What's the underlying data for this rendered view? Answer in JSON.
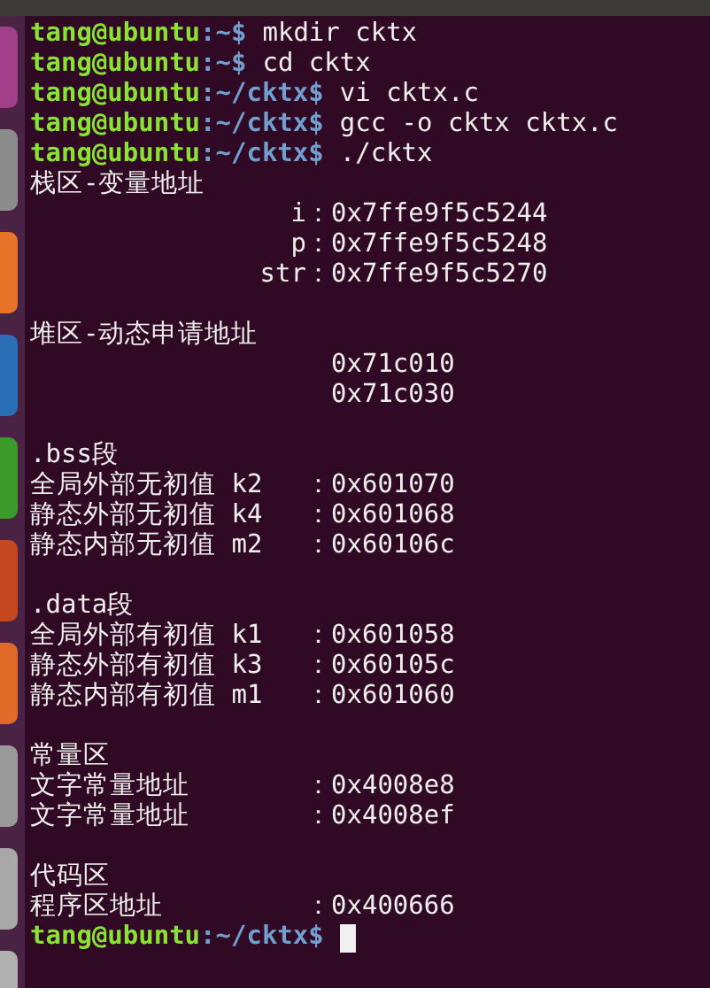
{
  "launcher": {
    "tiles": [
      {
        "color": "#a23f8a"
      },
      {
        "color": "#8c8c8c"
      },
      {
        "color": "#e8742a"
      },
      {
        "color": "#2a6fb5"
      },
      {
        "color": "#3c9a2a"
      },
      {
        "color": "#c4471f"
      },
      {
        "color": "#e06a28"
      },
      {
        "color": "#9a9a9a"
      },
      {
        "color": "#a8a8a8"
      },
      {
        "color": "#b0b0b0"
      }
    ]
  },
  "terminal": {
    "lines": [
      {
        "kind": "prompt",
        "user": "tang@ubuntu",
        "path": ":~$",
        "command": "mkdir cktx"
      },
      {
        "kind": "prompt",
        "user": "tang@ubuntu",
        "path": ":~$",
        "command": "cd cktx"
      },
      {
        "kind": "prompt",
        "user": "tang@ubuntu",
        "path": ":~/cktx$",
        "command": "vi cktx.c"
      },
      {
        "kind": "prompt",
        "user": "tang@ubuntu",
        "path": ":~/cktx$",
        "command": "gcc -o cktx cktx.c"
      },
      {
        "kind": "prompt",
        "user": "tang@ubuntu",
        "path": ":~/cktx$",
        "command": "./cktx"
      },
      {
        "kind": "heading",
        "text": "栈区-变量地址"
      },
      {
        "kind": "stack_address",
        "label": "i",
        "colon": "：",
        "value": "0x7ffe9f5c5244"
      },
      {
        "kind": "stack_address",
        "label": "p",
        "colon": "：",
        "value": "0x7ffe9f5c5248"
      },
      {
        "kind": "stack_address",
        "label": "str",
        "colon": "：",
        "value": "0x7ffe9f5c5270"
      },
      {
        "kind": "blank"
      },
      {
        "kind": "heading",
        "text": "堆区-动态申请地址"
      },
      {
        "kind": "address",
        "value": "0x71c010"
      },
      {
        "kind": "address",
        "value": "0x71c030"
      },
      {
        "kind": "blank"
      },
      {
        "kind": "heading",
        "text": ".bss段"
      },
      {
        "kind": "address",
        "label": "全局外部无初值 k2",
        "colon": "：",
        "value": "0x601070"
      },
      {
        "kind": "address",
        "label": "静态外部无初值 k4",
        "colon": "：",
        "value": "0x601068"
      },
      {
        "kind": "address",
        "label": "静态内部无初值 m2",
        "colon": "：",
        "value": "0x60106c"
      },
      {
        "kind": "blank"
      },
      {
        "kind": "heading",
        "text": ".data段"
      },
      {
        "kind": "address",
        "label": "全局外部有初值 k1",
        "colon": "：",
        "value": "0x601058"
      },
      {
        "kind": "address",
        "label": "静态外部有初值 k3",
        "colon": "：",
        "value": "0x60105c"
      },
      {
        "kind": "address",
        "label": "静态内部有初值 m1",
        "colon": "：",
        "value": "0x601060"
      },
      {
        "kind": "blank"
      },
      {
        "kind": "heading",
        "text": "常量区"
      },
      {
        "kind": "address",
        "label": "文字常量地址",
        "colon": "：",
        "value": "0x4008e8"
      },
      {
        "kind": "address",
        "label": "文字常量地址",
        "colon": "：",
        "value": "0x4008ef"
      },
      {
        "kind": "blank"
      },
      {
        "kind": "heading",
        "text": "代码区"
      },
      {
        "kind": "address",
        "label": "程序区地址",
        "colon": "：",
        "value": "0x400666"
      },
      {
        "kind": "prompt",
        "user": "tang@ubuntu",
        "path": ":~/cktx$",
        "cursor": true
      }
    ]
  }
}
